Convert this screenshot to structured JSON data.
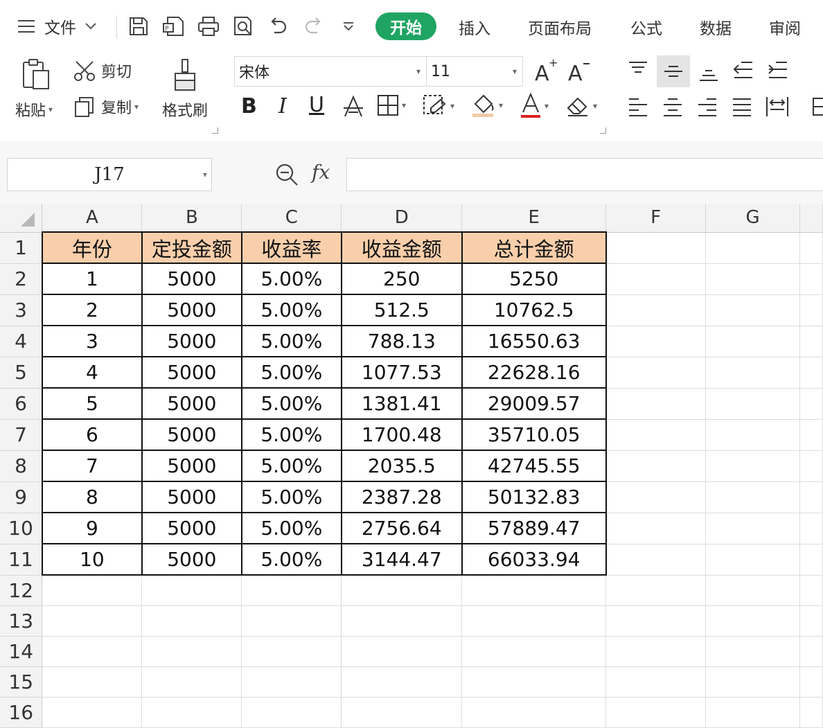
{
  "menubar": {
    "file_label": "文件",
    "tabs": [
      "开始",
      "插入",
      "页面布局",
      "公式",
      "数据",
      "审阅"
    ],
    "active_tab": "开始",
    "active_color": "#1fa463"
  },
  "ribbon": {
    "paste_label": "粘贴",
    "cut_label": "剪切",
    "copy_label": "复制",
    "format_painter_label": "格式刷",
    "font_name": "宋体",
    "font_size": "11",
    "bold_label": "B",
    "italic_label": "I",
    "underline_label": "U",
    "font_color_accent": "#e02020"
  },
  "formula_bar": {
    "name_box": "J17",
    "fx_label": "fx",
    "formula_value": ""
  },
  "sheet": {
    "columns": [
      "A",
      "B",
      "C",
      "D",
      "E",
      "F",
      "G"
    ],
    "row_numbers": [
      "1",
      "2",
      "3",
      "4",
      "5",
      "6",
      "7",
      "8",
      "9",
      "10",
      "11",
      "12",
      "13",
      "14",
      "15",
      "16"
    ],
    "header_fill": "#f9cfab",
    "rows": [
      [
        "年份",
        "定投金额",
        "收益率",
        "收益金额",
        "总计金额"
      ],
      [
        "1",
        "5000",
        "5.00%",
        "250",
        "5250"
      ],
      [
        "2",
        "5000",
        "5.00%",
        "512.5",
        "10762.5"
      ],
      [
        "3",
        "5000",
        "5.00%",
        "788.13",
        "16550.63"
      ],
      [
        "4",
        "5000",
        "5.00%",
        "1077.53",
        "22628.16"
      ],
      [
        "5",
        "5000",
        "5.00%",
        "1381.41",
        "29009.57"
      ],
      [
        "6",
        "5000",
        "5.00%",
        "1700.48",
        "35710.05"
      ],
      [
        "7",
        "5000",
        "5.00%",
        "2035.5",
        "42745.55"
      ],
      [
        "8",
        "5000",
        "5.00%",
        "2387.28",
        "50132.83"
      ],
      [
        "9",
        "5000",
        "5.00%",
        "2756.64",
        "57889.47"
      ],
      [
        "10",
        "5000",
        "5.00%",
        "3144.47",
        "66033.94"
      ]
    ]
  }
}
